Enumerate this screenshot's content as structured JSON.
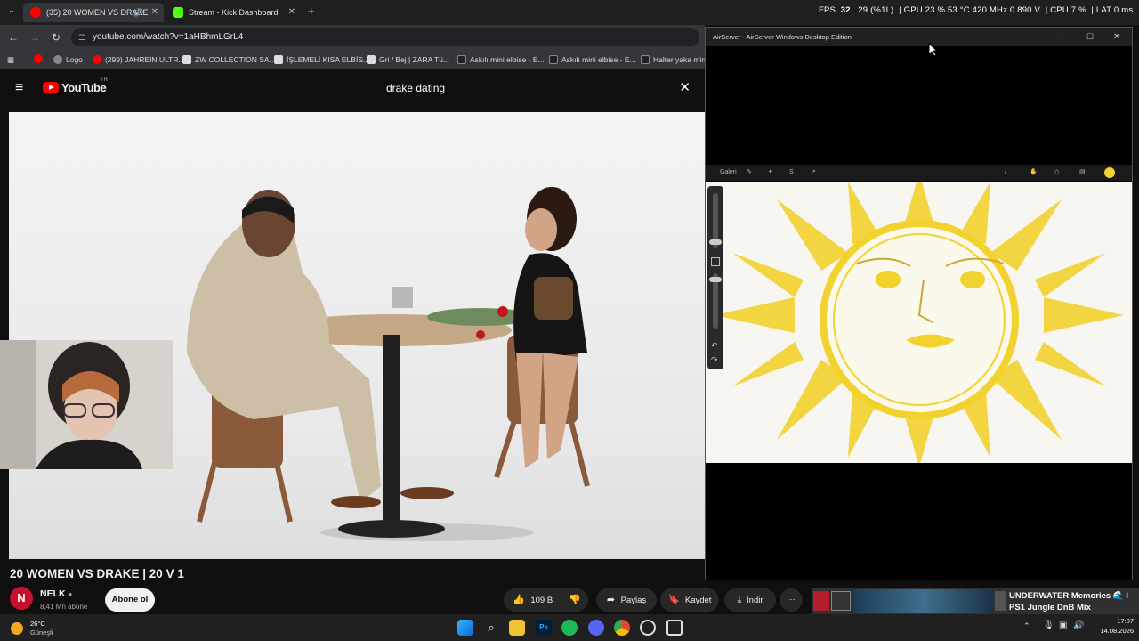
{
  "browser": {
    "tabs": [
      {
        "label": "(35) 20 WOMEN VS DRAKE",
        "active": true
      },
      {
        "label": "Stream - Kick Dashboard",
        "active": false
      }
    ],
    "url": "youtube.com/watch?v=1aHBhmLGrL4",
    "bookmarks": [
      "Logo",
      "(299) JAHREIN ULTR...",
      "ZW COLLECTION SA...",
      "İŞLEMELİ KISA ELBİS...",
      "Gri / Bej | ZARA Tü...",
      "Askılı mini elbise - E...",
      "Askılı mini elbise - E...",
      "Halter yaka mini"
    ]
  },
  "stats": {
    "fps_label": "FPS",
    "fps": "32",
    "fps_extra": "29 (%1L)",
    "gpu_label": "GPU",
    "gpu": "23 %  53 °C  420 MHz  0.890 V",
    "cpu_label": "CPU",
    "cpu": "7 %",
    "lat_label": "LAT",
    "lat": "0 ms"
  },
  "youtube": {
    "logo": "YouTube",
    "logo_region": "TR",
    "search_value": "drake dating",
    "video_title": "20 WOMEN VS DRAKE | 20 V 1",
    "channel_name": "NELK",
    "channel_initial": "N",
    "subscribers": "8,41 Mn abone",
    "subscribe_label": "Abone ol",
    "likes": "109 B",
    "share_label": "Paylaş",
    "save_label": "Kaydet",
    "download_label": "İndir",
    "more_label": "···"
  },
  "airserver": {
    "title": "AirServer - AirServer Windows Desktop Edition",
    "gallery_label": "Galeri"
  },
  "strip": {
    "recommend_title": "UNDERWATER Memories 🌊 I",
    "recommend_sub": "PS1 Jungle DnB Mix"
  },
  "taskbar": {
    "weather_temp": "26°C",
    "weather_desc": "Güneşli",
    "time": "17:07",
    "date": "14.08.2026"
  },
  "colors": {
    "youtube_red": "#ff0000",
    "sun_yellow": "#f2d22e",
    "kick_green": "#53fc18"
  }
}
